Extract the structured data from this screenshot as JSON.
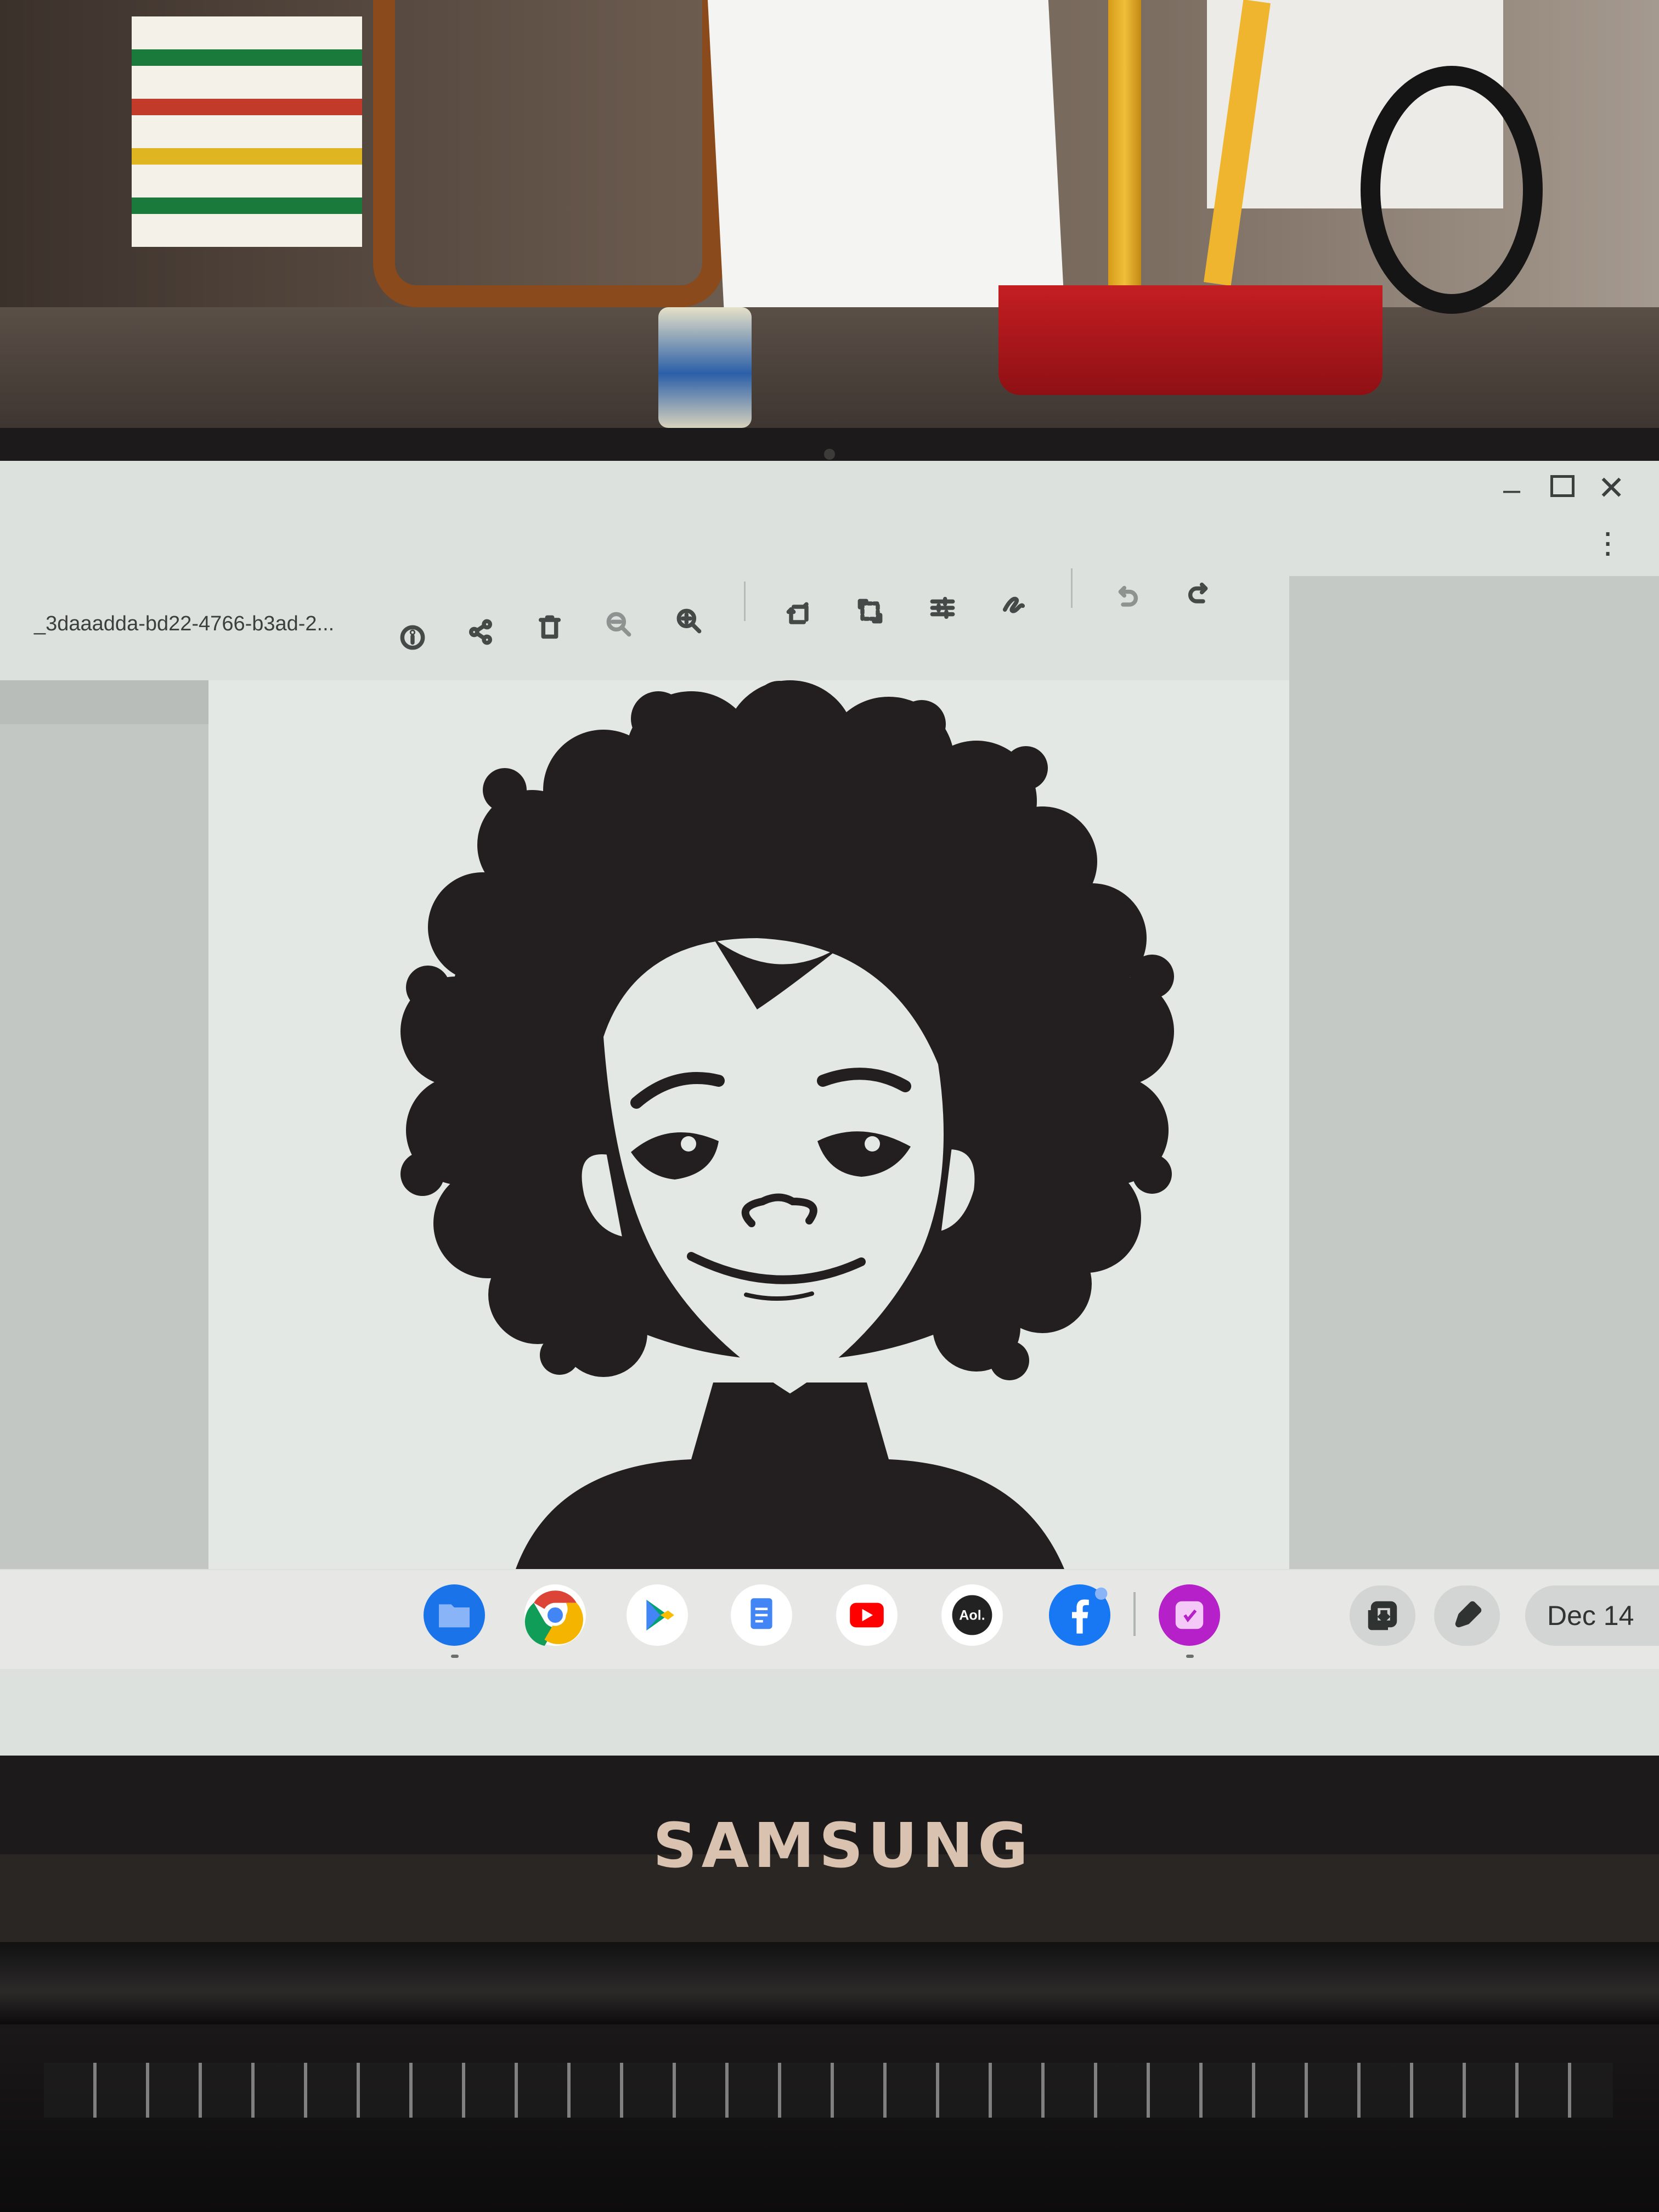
{
  "viewer": {
    "filename": "_3daaadda-bd22-4766-b3ad-2...",
    "toolbar_icons": [
      "info-icon",
      "share-icon",
      "delete-icon",
      "zoom-out-icon",
      "zoom-in-icon",
      "rotate-icon",
      "crop-icon",
      "adjust-icon",
      "draw-icon",
      "undo-icon",
      "redo-icon"
    ],
    "window_controls": [
      "minimize-icon",
      "maximize-icon",
      "close-icon",
      "more-options-icon"
    ]
  },
  "shelf": {
    "apps": [
      "files",
      "chrome",
      "play-store",
      "docs",
      "youtube",
      "aol",
      "facebook",
      "gallery"
    ],
    "tray_icons": [
      "screenshot-icon",
      "stylus-icon"
    ],
    "date": "Dec 14"
  },
  "device": {
    "brand": "SAMSUNG"
  },
  "colors": {
    "screen_bg": "#dde1de",
    "shelf_bg": "#e7e8e6",
    "artwork_ink": "#231f20"
  }
}
